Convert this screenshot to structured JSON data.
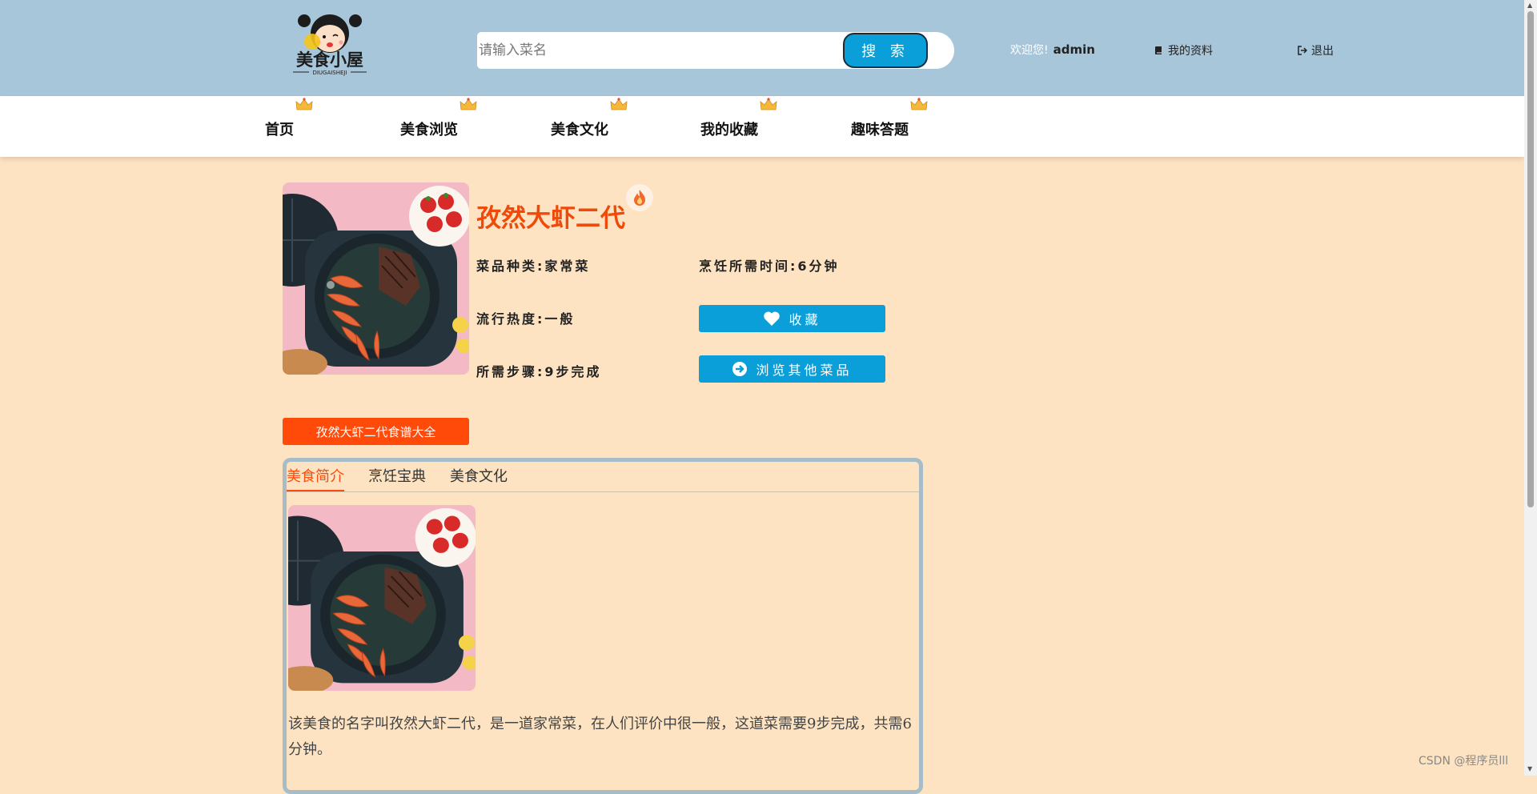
{
  "header": {
    "logo_text": "美食小屋",
    "logo_sub": "DIUGAISHEJI",
    "search_placeholder": "请输入菜名",
    "search_button": "搜 索",
    "welcome_text": "欢迎您!",
    "username": "admin",
    "profile_link": "我的资料",
    "logout_link": "退出"
  },
  "nav": {
    "items": [
      {
        "label": "首页"
      },
      {
        "label": "美食浏览"
      },
      {
        "label": "美食文化"
      },
      {
        "label": "我的收藏"
      },
      {
        "label": "趣味答题"
      }
    ],
    "crown_icon": "crown-icon"
  },
  "dish": {
    "title": "孜然大虾二代",
    "category": "菜品种类:家常菜",
    "cook_time": "烹饪所需时间:6分钟",
    "popularity": "流行热度:一般",
    "steps": "所需步骤:9步完成",
    "favorite_button": "收藏",
    "browse_button": "浏览其他菜品",
    "recipe_tag": "孜然大虾二代食谱大全"
  },
  "tabs": {
    "items": [
      {
        "label": "美食简介"
      },
      {
        "label": "烹饪宝典"
      },
      {
        "label": "美食文化"
      }
    ],
    "active": 0
  },
  "intro": {
    "description": "该美食的名字叫孜然大虾二代，是一道家常菜，在人们评价中很一般，这道菜需要9步完成，共需6分钟。"
  },
  "watermark": "CSDN @程序员lll",
  "colors": {
    "header_bg": "#a8c6da",
    "page_bg": "#fde3c1",
    "accent_blue": "#0a9fd8",
    "accent_orange": "#ff4a0a"
  }
}
